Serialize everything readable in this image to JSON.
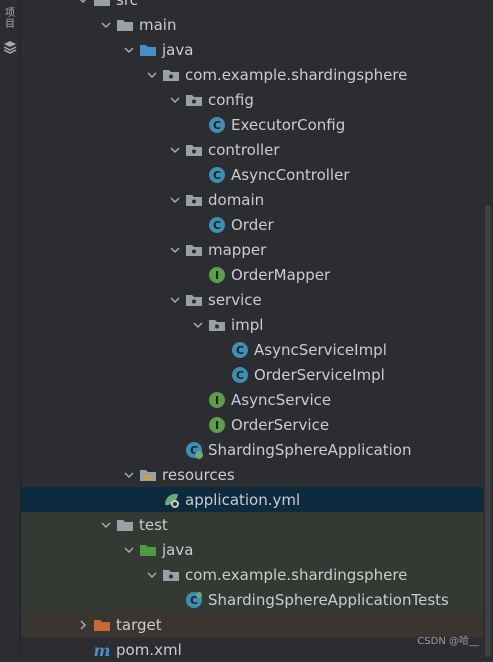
{
  "sidebar": {
    "strip_text": "项目"
  },
  "tree": [
    {
      "label": "src",
      "depth": 0,
      "arrow": "down",
      "icon": "folder"
    },
    {
      "label": "main",
      "depth": 1,
      "arrow": "down",
      "icon": "folder"
    },
    {
      "label": "java",
      "depth": 2,
      "arrow": "down",
      "icon": "folder-source"
    },
    {
      "label": "com.example.shardingsphere",
      "depth": 3,
      "arrow": "down",
      "icon": "package"
    },
    {
      "label": "config",
      "depth": 4,
      "arrow": "down",
      "icon": "package"
    },
    {
      "label": "ExecutorConfig",
      "depth": 5,
      "arrow": "none",
      "icon": "class"
    },
    {
      "label": "controller",
      "depth": 4,
      "arrow": "down",
      "icon": "package"
    },
    {
      "label": "AsyncController",
      "depth": 5,
      "arrow": "none",
      "icon": "class"
    },
    {
      "label": "domain",
      "depth": 4,
      "arrow": "down",
      "icon": "package"
    },
    {
      "label": "Order",
      "depth": 5,
      "arrow": "none",
      "icon": "class"
    },
    {
      "label": "mapper",
      "depth": 4,
      "arrow": "down",
      "icon": "package"
    },
    {
      "label": "OrderMapper",
      "depth": 5,
      "arrow": "none",
      "icon": "interface"
    },
    {
      "label": "service",
      "depth": 4,
      "arrow": "down",
      "icon": "package"
    },
    {
      "label": "impl",
      "depth": 5,
      "arrow": "down",
      "icon": "package"
    },
    {
      "label": "AsyncServiceImpl",
      "depth": 6,
      "arrow": "none",
      "icon": "class"
    },
    {
      "label": "OrderServiceImpl",
      "depth": 6,
      "arrow": "none",
      "icon": "class"
    },
    {
      "label": "AsyncService",
      "depth": 5,
      "arrow": "none",
      "icon": "interface"
    },
    {
      "label": "OrderService",
      "depth": 5,
      "arrow": "none",
      "icon": "interface"
    },
    {
      "label": "ShardingSphereApplication",
      "depth": 4,
      "arrow": "none",
      "icon": "spring-class"
    },
    {
      "label": "resources",
      "depth": 2,
      "arrow": "down",
      "icon": "folder-resources"
    },
    {
      "label": "application.yml",
      "depth": 3,
      "arrow": "none",
      "icon": "spring-yml",
      "state": "selected"
    },
    {
      "label": "test",
      "depth": 1,
      "arrow": "down",
      "icon": "folder",
      "state": "test"
    },
    {
      "label": "java",
      "depth": 2,
      "arrow": "down",
      "icon": "folder-test",
      "state": "test"
    },
    {
      "label": "com.example.shardingsphere",
      "depth": 3,
      "arrow": "down",
      "icon": "package",
      "state": "test"
    },
    {
      "label": "ShardingSphereApplicationTests",
      "depth": 4,
      "arrow": "none",
      "icon": "spring-test-class",
      "state": "test"
    },
    {
      "label": "target",
      "depth": 0,
      "arrow": "right",
      "icon": "folder-excluded",
      "state": "excluded"
    },
    {
      "label": "pom.xml",
      "depth": 0,
      "arrow": "none",
      "icon": "maven"
    }
  ],
  "watermark": "CSDN @哈__",
  "colors": {
    "background": "#2b2d30",
    "selected_row": "#0e2a3f",
    "test_row": "#343a33",
    "excluded_row": "#3b3530",
    "class_icon": "#3d8fb5",
    "interface_icon": "#5c9e4a",
    "source_folder": "#4a8cc4",
    "test_folder": "#4e9a45",
    "excluded_folder": "#c46a36"
  }
}
